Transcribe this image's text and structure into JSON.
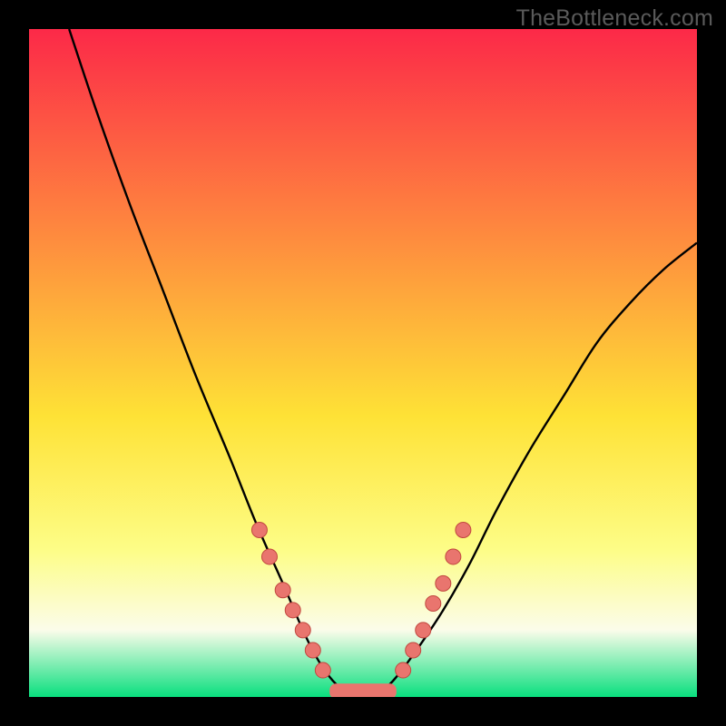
{
  "watermark": "TheBottleneck.com",
  "colors": {
    "background_black": "#000000",
    "gradient_top": "#fc2948",
    "gradient_mid1": "#fe8e3e",
    "gradient_mid2": "#fee236",
    "gradient_mid3": "#fdfd87",
    "gradient_mid4": "#fbfcea",
    "gradient_bottom": "#09df7e",
    "curve": "#000000",
    "dot_fill": "#e9756e",
    "dot_stroke": "#c1483f",
    "bottom_band": "#e9756e"
  },
  "chart_data": {
    "type": "line",
    "title": "",
    "xlabel": "",
    "ylabel": "",
    "xlim": [
      0,
      100
    ],
    "ylim": [
      0,
      100
    ],
    "grid": false,
    "legend": false,
    "series": [
      {
        "name": "bottleneck-curve",
        "x": [
          6,
          10,
          15,
          20,
          25,
          30,
          34,
          38,
          41,
          43,
          45,
          47,
          49,
          51,
          53,
          55,
          58,
          62,
          66,
          70,
          75,
          80,
          85,
          90,
          95,
          100
        ],
        "y": [
          100,
          88,
          74,
          61,
          48,
          36,
          26,
          17,
          10,
          6,
          3,
          1,
          0,
          0,
          1,
          3,
          7,
          13,
          20,
          28,
          37,
          45,
          53,
          59,
          64,
          68
        ]
      }
    ],
    "flat_bottom_band": {
      "x_start": 45,
      "x_end": 55,
      "y": 0,
      "height": 2
    },
    "dots_left": [
      {
        "x": 34.5,
        "y": 25
      },
      {
        "x": 36.0,
        "y": 21
      },
      {
        "x": 38.0,
        "y": 16
      },
      {
        "x": 39.5,
        "y": 13
      },
      {
        "x": 41.0,
        "y": 10
      },
      {
        "x": 42.5,
        "y": 7
      },
      {
        "x": 44.0,
        "y": 4
      }
    ],
    "dots_right": [
      {
        "x": 56.0,
        "y": 4
      },
      {
        "x": 57.5,
        "y": 7
      },
      {
        "x": 59.0,
        "y": 10
      },
      {
        "x": 60.5,
        "y": 14
      },
      {
        "x": 62.0,
        "y": 17
      },
      {
        "x": 63.5,
        "y": 21
      },
      {
        "x": 65.0,
        "y": 25
      }
    ]
  }
}
